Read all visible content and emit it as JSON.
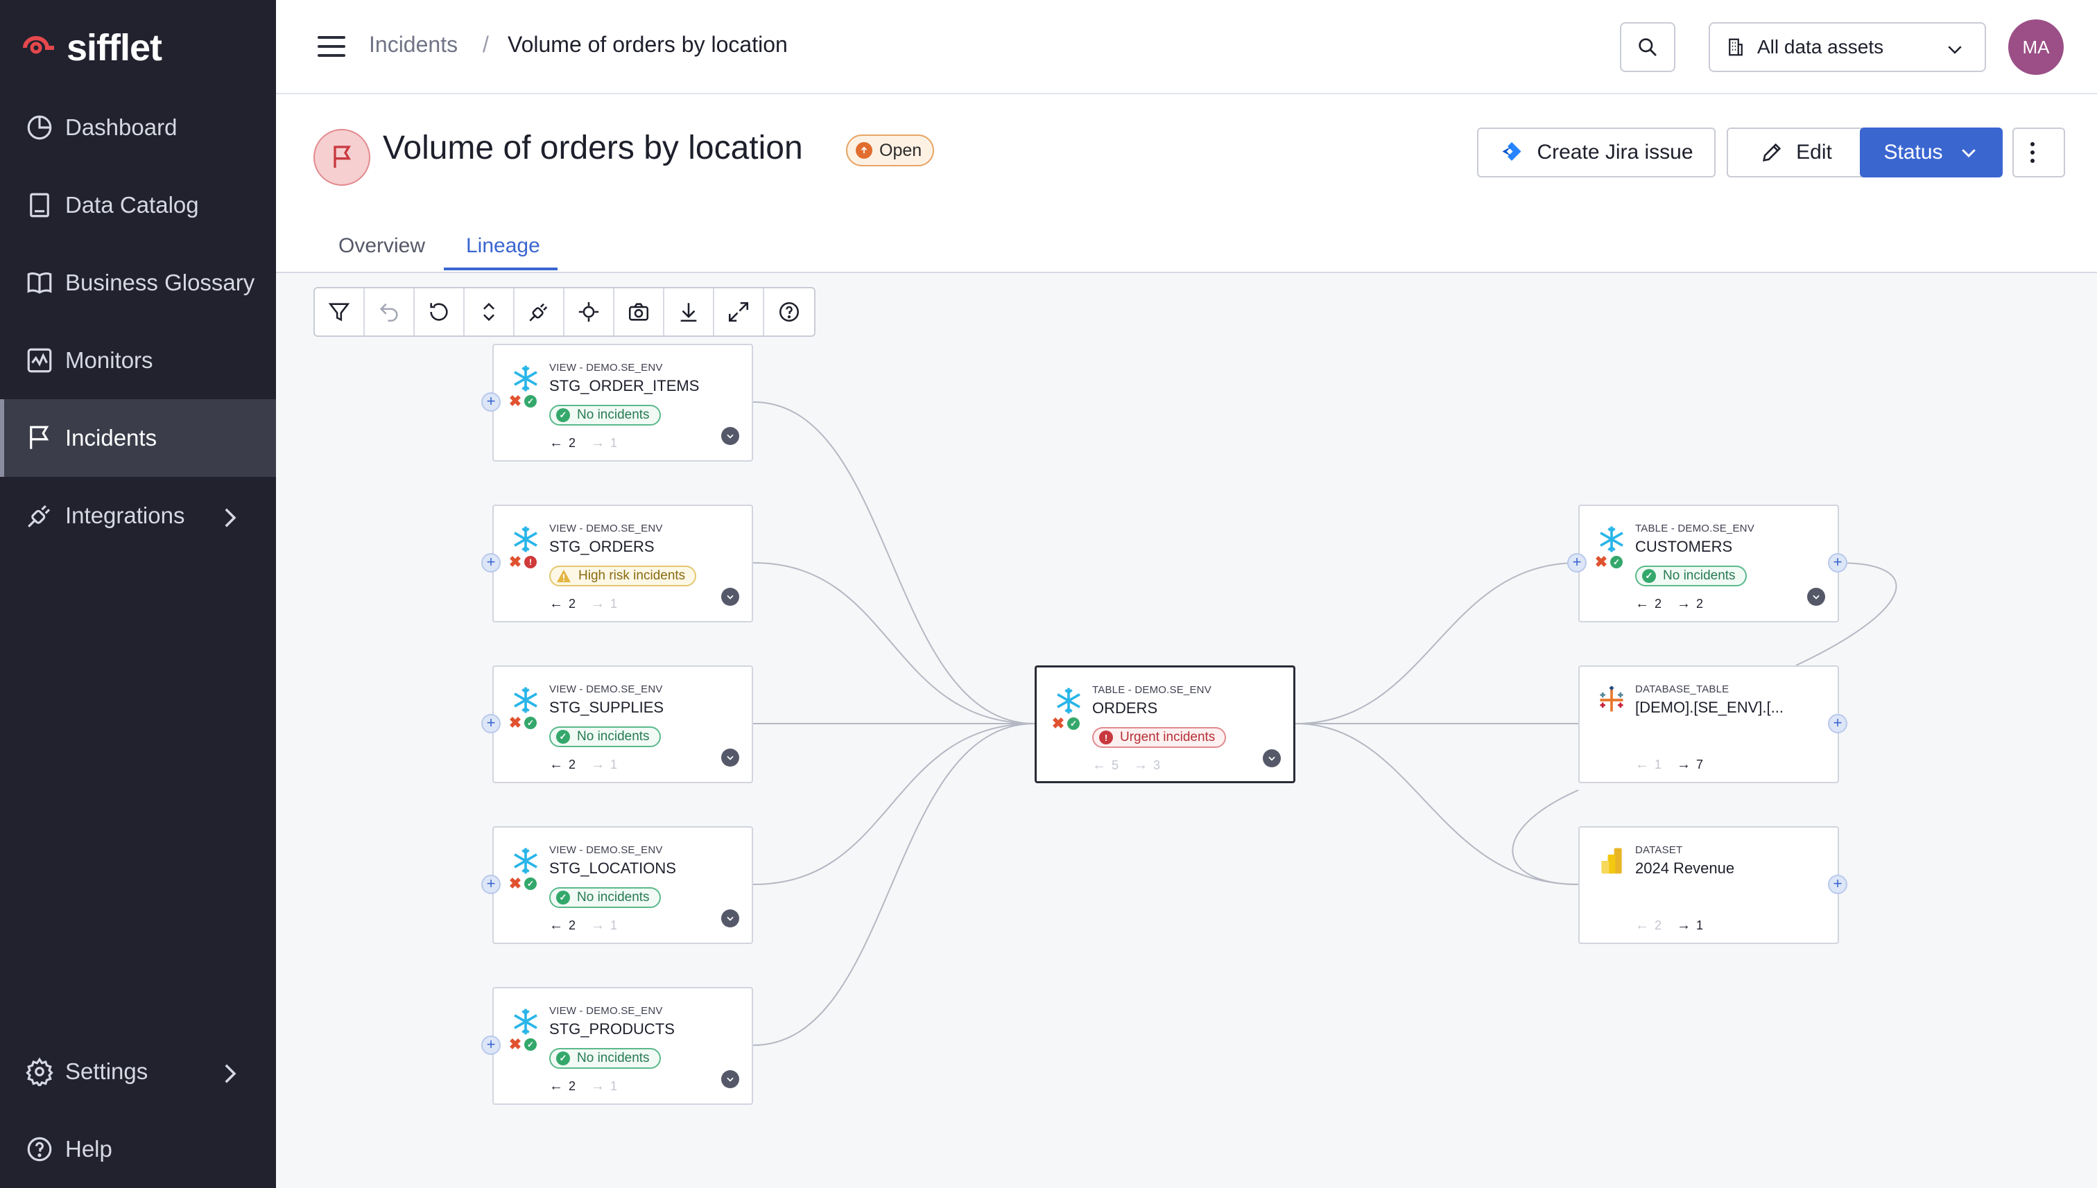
{
  "app": {
    "name": "sifflet"
  },
  "sidebar": {
    "items": [
      {
        "label": "Dashboard"
      },
      {
        "label": "Data Catalog"
      },
      {
        "label": "Business Glossary"
      },
      {
        "label": "Monitors"
      },
      {
        "label": "Incidents"
      },
      {
        "label": "Integrations"
      }
    ],
    "bottom": [
      {
        "label": "Settings"
      },
      {
        "label": "Help"
      }
    ]
  },
  "topbar": {
    "breadcrumb": [
      "Incidents",
      "/",
      "Volume of orders by location"
    ],
    "assets_filter": "All data assets",
    "avatar_initials": "MA"
  },
  "incident": {
    "title": "Volume of orders by location",
    "status_badge": "Open",
    "actions": {
      "jira": "Create Jira issue",
      "edit": "Edit",
      "status": "Status"
    }
  },
  "tabs": [
    {
      "label": "Overview"
    },
    {
      "label": "Lineage"
    }
  ],
  "colors": {
    "sidebar_bg": "#21222e",
    "accent": "#3a66d0",
    "ok": "#34a86b",
    "urgent": "#c8393f",
    "warn": "#e4c66c"
  },
  "lineage": {
    "nodes": [
      {
        "type": "VIEW - DEMO.SE_ENV",
        "name": "STG_ORDER_ITEMS",
        "status": "No incidents",
        "up": "2",
        "down": "1"
      },
      {
        "type": "VIEW - DEMO.SE_ENV",
        "name": "STG_ORDERS",
        "status": "High risk incidents",
        "up": "2",
        "down": "1"
      },
      {
        "type": "VIEW - DEMO.SE_ENV",
        "name": "STG_SUPPLIES",
        "status": "No incidents",
        "up": "2",
        "down": "1"
      },
      {
        "type": "VIEW - DEMO.SE_ENV",
        "name": "STG_LOCATIONS",
        "status": "No incidents",
        "up": "2",
        "down": "1"
      },
      {
        "type": "VIEW - DEMO.SE_ENV",
        "name": "STG_PRODUCTS",
        "status": "No incidents",
        "up": "2",
        "down": "1"
      },
      {
        "type": "TABLE - DEMO.SE_ENV",
        "name": "ORDERS",
        "status": "Urgent incidents",
        "up": "5",
        "down": "3"
      },
      {
        "type": "TABLE - DEMO.SE_ENV",
        "name": "CUSTOMERS",
        "status": "No incidents",
        "up": "2",
        "down": "2"
      },
      {
        "type": "DATABASE_TABLE",
        "name": "[DEMO].[SE_ENV].[...",
        "status": "",
        "up": "1",
        "down": "7"
      },
      {
        "type": "DATASET",
        "name": "2024 Revenue",
        "status": "",
        "up": "2",
        "down": "1"
      }
    ]
  }
}
